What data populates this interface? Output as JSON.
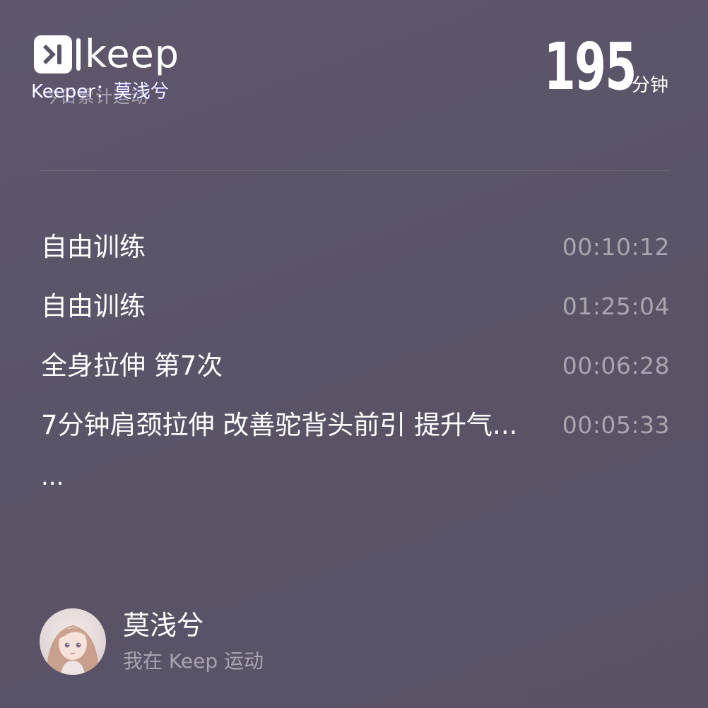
{
  "brand": {
    "logo_icon": "keep-logo-icon",
    "word": "keep"
  },
  "header": {
    "subtitle_ghost": "今日累计运动",
    "keeper_line": "Keeper：莫浅兮",
    "minutes_value": "195",
    "minutes_unit": "分钟"
  },
  "records": [
    {
      "name": "自由训练",
      "time": "00:10:12"
    },
    {
      "name": "自由训练",
      "time": "01:25:04"
    },
    {
      "name": "全身拉伸 第7次",
      "time": "00:06:28"
    },
    {
      "name": "7分钟肩颈拉伸 改善驼背头前引 提升气...",
      "time": "00:05:33"
    }
  ],
  "more": "...",
  "user": {
    "avatar_icon": "user-avatar",
    "name": "莫浅兮",
    "tagline": "我在 Keep 运动"
  },
  "colors": {
    "background": "#5c5468",
    "text_primary": "#ffffff",
    "text_secondary": "rgba(255,255,255,0.48)"
  }
}
